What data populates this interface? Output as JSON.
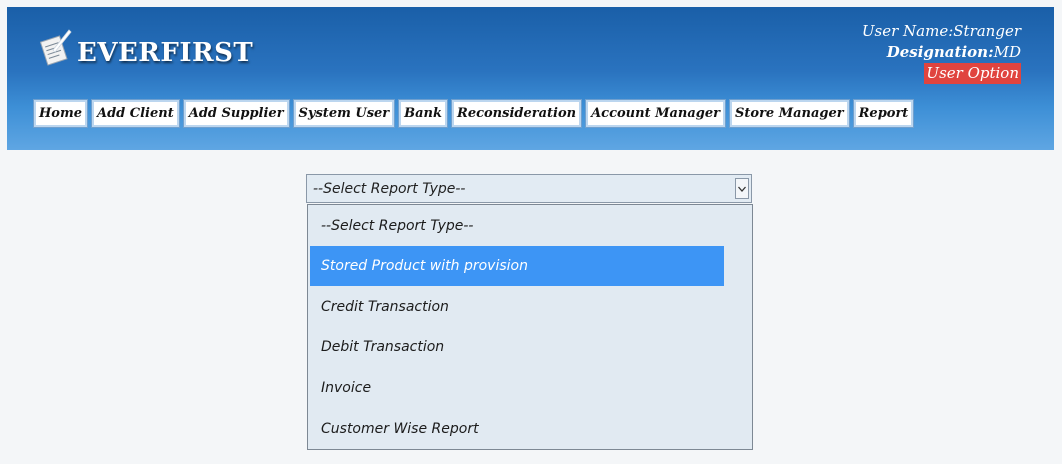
{
  "brand": {
    "name": "EVERFIRST"
  },
  "user": {
    "name_label": "User Name:",
    "name_value": "Stranger",
    "designation_label": "Designation:",
    "designation_value": "MD",
    "option_label": "User Option"
  },
  "nav": {
    "items": [
      {
        "label": "Home"
      },
      {
        "label": "Add Client"
      },
      {
        "label": "Add Supplier"
      },
      {
        "label": "System User"
      },
      {
        "label": "Bank"
      },
      {
        "label": "Reconsideration"
      },
      {
        "label": "Account Manager"
      },
      {
        "label": "Store Manager"
      },
      {
        "label": "Report"
      }
    ]
  },
  "report_select": {
    "selected_value": "--Select Report Type--",
    "options": [
      {
        "label": "--Select Report Type--",
        "highlighted": false
      },
      {
        "label": "Stored Product with provision",
        "highlighted": true
      },
      {
        "label": "Credit Transaction",
        "highlighted": false
      },
      {
        "label": "Debit Transaction",
        "highlighted": false
      },
      {
        "label": "Invoice",
        "highlighted": false
      },
      {
        "label": "Customer Wise Report",
        "highlighted": false
      }
    ]
  },
  "colors": {
    "header_top": "#1a5fa8",
    "header_bottom": "#5fa6e3",
    "user_option_bg": "#e0443f",
    "highlight": "#3d95f5",
    "dropdown_bg": "#e1eaf2"
  },
  "icons": {
    "logo": "notepad-quill-icon",
    "select_arrow": "chevron-down-icon"
  }
}
